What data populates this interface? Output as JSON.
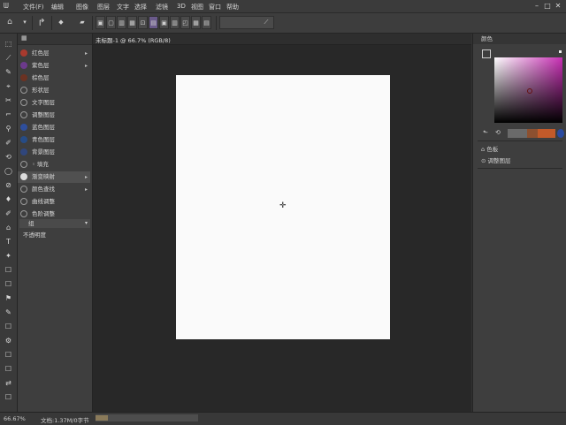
{
  "menubar": {
    "logo": "ᗯ",
    "items": [
      "文件(F)",
      "编辑",
      "图像",
      "图层",
      "文字",
      "选择",
      "滤镜",
      "3D",
      "视图",
      "窗口",
      "帮助"
    ],
    "min": "–",
    "max": "□",
    "close": "✕"
  },
  "options": {
    "tool_glyph": "↱",
    "mode_glyph": "◆",
    "buttons": [
      "▣",
      "▢",
      "▥",
      "▦",
      "⊡",
      "▤",
      "▣",
      "▥",
      "◰",
      "▦",
      "▤",
      "⟋"
    ]
  },
  "document": {
    "tab_title": "未标题-1 @ 66.7% (RGB/8)"
  },
  "tools": [
    "⬚",
    "⟋",
    "✎",
    "⌖",
    "✂",
    "⌐",
    "⚲",
    "✐",
    "⟲",
    "◯",
    "⊘",
    "♦",
    "✐",
    "⌂",
    "T",
    "✦",
    "☐",
    "☐",
    "⚑",
    "✎",
    "☐",
    "⚙",
    "☐",
    "☐",
    "⇄",
    "☐"
  ],
  "layers": {
    "header_glyph": "▦",
    "rows": [
      {
        "label": "红色层",
        "color": "#a83a2e",
        "arrow": "▸"
      },
      {
        "label": "紫色层",
        "color": "#6c3a8c",
        "arrow": "▸"
      },
      {
        "label": "棕色层",
        "color": "#6b3222",
        "arrow": ""
      },
      {
        "label": "形状层",
        "color": "",
        "arrow": ""
      },
      {
        "label": "文字图层",
        "color": "",
        "arrow": ""
      },
      {
        "label": "调整图层",
        "color": "",
        "arrow": ""
      },
      {
        "label": "蓝色图层",
        "color": "#2e4e9c",
        "arrow": ""
      },
      {
        "label": "青色图层",
        "color": "#264c86",
        "arrow": ""
      },
      {
        "label": "背景图层",
        "color": "#30467c",
        "arrow": ""
      },
      {
        "label": "◦ 填充",
        "color": "",
        "arrow": ""
      },
      {
        "label": "渐变映射",
        "color": "#dcdcdc",
        "arrow": "▸"
      },
      {
        "label": "颜色查找",
        "color": "",
        "arrow": "▸"
      },
      {
        "label": "曲线调整",
        "color": "",
        "arrow": ""
      },
      {
        "label": "色阶调整",
        "color": "",
        "arrow": ""
      }
    ],
    "group_label": "组",
    "footer_label": "不透明度"
  },
  "right_panel": {
    "title": "颜色",
    "row1": "⌂ 色板",
    "row2": "⊙ 调整图层",
    "swatch_colors": [
      "#6a6a6a",
      "#8c5030",
      "#c25a2a",
      "#2a4aa0"
    ]
  },
  "status": {
    "zoom": "66.67%",
    "doc_info": "文档:1.37M/0字节"
  }
}
